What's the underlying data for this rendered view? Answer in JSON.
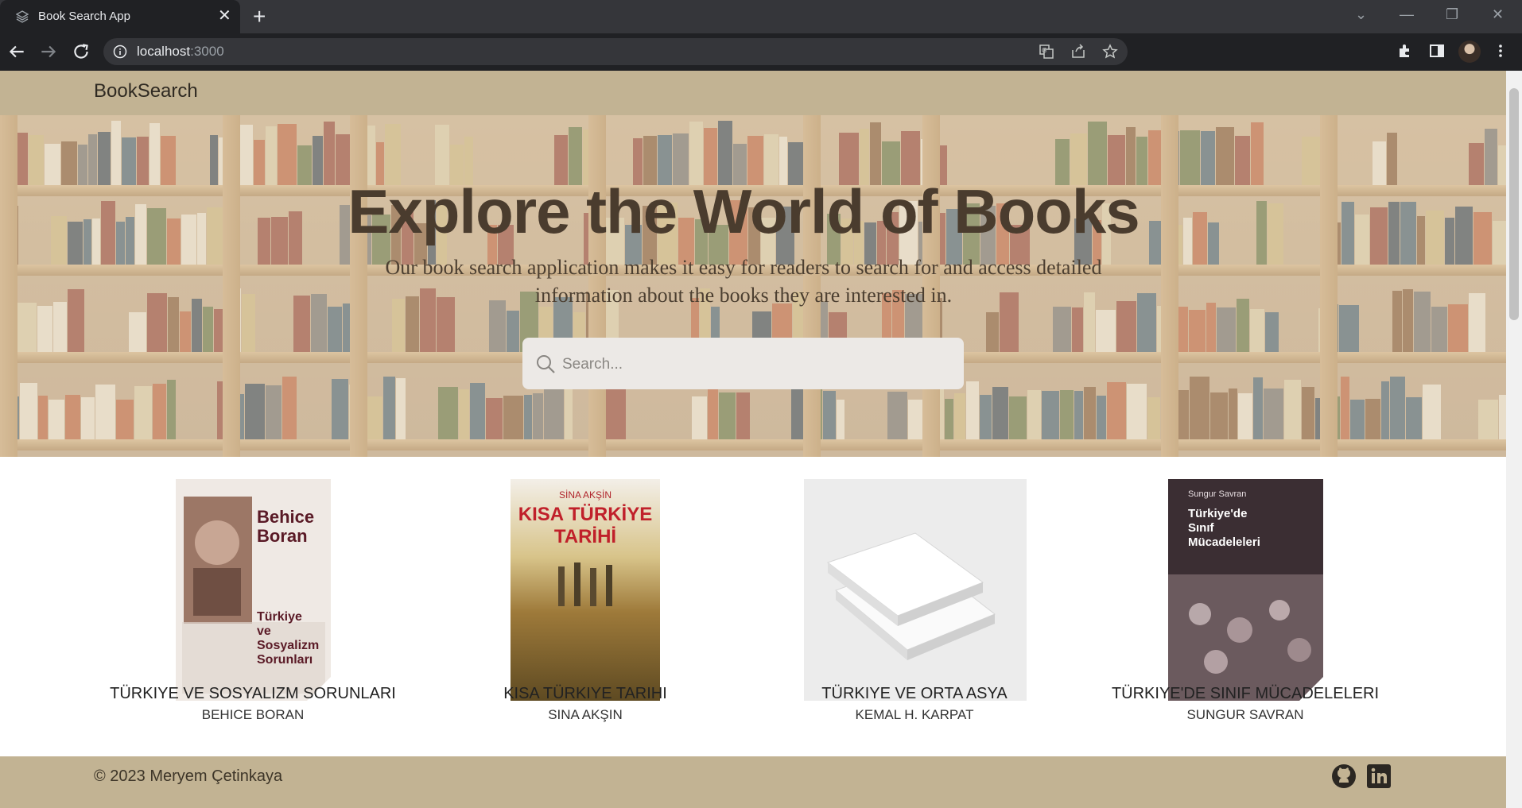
{
  "browser": {
    "tab_title": "Book Search App",
    "tab_close": "✕",
    "new_tab": "+",
    "url_host": "localhost",
    "url_port": ":3000",
    "window_controls": [
      "⌄",
      "—",
      "❐",
      "✕"
    ]
  },
  "navbar": {
    "brand": "BookSearch"
  },
  "hero": {
    "title": "Explore the World of Books",
    "subtitle": "Our book search application makes it easy for readers to search for and access detailed information about the books they are interested in.",
    "search_placeholder": "Search..."
  },
  "books": [
    {
      "title": "TÜRKIYE VE SOSYALIZM SORUNLARI",
      "author": "BEHICE BORAN",
      "cover_lines": [
        "Behice",
        "Boran",
        "Türkiye",
        "ve",
        "Sosyalizm",
        "Sorunları"
      ]
    },
    {
      "title": "KISA TÜRKIYE TARIHI",
      "author": "SINA AKŞIN",
      "cover_lines": [
        "SİNA AKŞİN",
        "KISA TÜRKİYE",
        "TARİHİ"
      ]
    },
    {
      "title": "TÜRKIYE VE ORTA ASYA",
      "author": "KEMAL H. KARPAT",
      "cover_lines": []
    },
    {
      "title": "TÜRKIYE'DE SINIF MÜCADELELERI",
      "author": "SUNGUR SAVRAN",
      "cover_lines": [
        "Sungur Savran",
        "Türkiye'de",
        "Sınıf",
        "Mücadeleleri"
      ]
    }
  ],
  "footer": {
    "copyright": "© 2023 Meryem Çetinkaya"
  },
  "icons": [
    "back-icon",
    "forward-icon",
    "reload-icon",
    "info-icon",
    "translate-icon",
    "share-icon",
    "star-icon",
    "extensions-icon",
    "sidepanel-icon",
    "menu-icon",
    "search-icon",
    "github-icon",
    "linkedin-icon"
  ],
  "colors": {
    "navbar": "#c2b393",
    "footer": "#c2b393",
    "hero_title": "#4a3c2e"
  }
}
